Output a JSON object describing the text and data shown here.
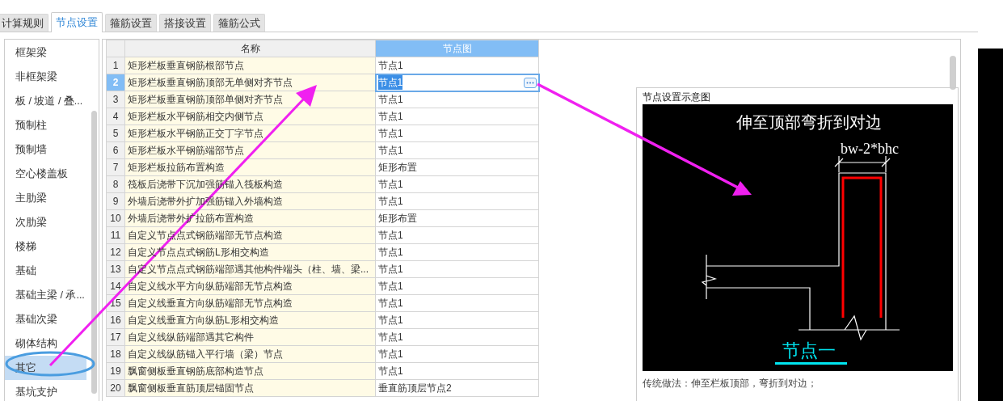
{
  "tabs": [
    {
      "label": "计算规则",
      "selected": false
    },
    {
      "label": "节点设置",
      "selected": true
    },
    {
      "label": "箍筋设置",
      "selected": false
    },
    {
      "label": "搭接设置",
      "selected": false
    },
    {
      "label": "箍筋公式",
      "selected": false
    }
  ],
  "sidebar": {
    "items": [
      {
        "label": "框架梁",
        "selected": false
      },
      {
        "label": "非框架梁",
        "selected": false
      },
      {
        "label": "板 / 坡道 / 叠...",
        "selected": false
      },
      {
        "label": "预制柱",
        "selected": false
      },
      {
        "label": "预制墙",
        "selected": false
      },
      {
        "label": "空心楼盖板",
        "selected": false
      },
      {
        "label": "主肋梁",
        "selected": false
      },
      {
        "label": "次肋梁",
        "selected": false
      },
      {
        "label": "楼梯",
        "selected": false
      },
      {
        "label": "基础",
        "selected": false
      },
      {
        "label": "基础主梁 / 承...",
        "selected": false
      },
      {
        "label": "基础次梁",
        "selected": false
      },
      {
        "label": "砌体结构",
        "selected": false
      },
      {
        "label": "其它",
        "selected": true
      },
      {
        "label": "基坑支护",
        "selected": false
      }
    ]
  },
  "table": {
    "columns": [
      {
        "label": "名称",
        "selected": false
      },
      {
        "label": "节点图",
        "selected": true
      }
    ],
    "rows": [
      {
        "number": "1",
        "name": "矩形栏板垂直钢筋根部节点",
        "node": "节点1",
        "selected": false
      },
      {
        "number": "2",
        "name": "矩形栏板垂直钢筋顶部无单侧对齐节点",
        "node": "节点1",
        "selected": true
      },
      {
        "number": "3",
        "name": "矩形栏板垂直钢筋顶部单侧对齐节点",
        "node": "节点1",
        "selected": false
      },
      {
        "number": "4",
        "name": "矩形栏板水平钢筋相交内侧节点",
        "node": "节点1",
        "selected": false
      },
      {
        "number": "5",
        "name": "矩形栏板水平钢筋正交丁字节点",
        "node": "节点1",
        "selected": false
      },
      {
        "number": "6",
        "name": "矩形栏板水平钢筋端部节点",
        "node": "节点1",
        "selected": false
      },
      {
        "number": "7",
        "name": "矩形栏板拉筋布置构造",
        "node": "矩形布置",
        "selected": false
      },
      {
        "number": "8",
        "name": "筏板后浇带下沉加强筋锚入筏板构造",
        "node": "节点1",
        "selected": false
      },
      {
        "number": "9",
        "name": "外墙后浇带外扩加强筋锚入外墙构造",
        "node": "节点1",
        "selected": false
      },
      {
        "number": "10",
        "name": "外墙后浇带外扩拉筋布置构造",
        "node": "矩形布置",
        "selected": false
      },
      {
        "number": "11",
        "name": "自定义节点点式钢筋端部无节点构造",
        "node": "节点1",
        "selected": false
      },
      {
        "number": "12",
        "name": "自定义节点点式钢筋L形相交构造",
        "node": "节点1",
        "selected": false
      },
      {
        "number": "13",
        "name": "自定义节点点式钢筋端部遇其他构件端头（柱、墙、梁...",
        "node": "节点1",
        "selected": false
      },
      {
        "number": "14",
        "name": "自定义线水平方向纵筋端部无节点构造",
        "node": "节点1",
        "selected": false
      },
      {
        "number": "15",
        "name": "自定义线垂直方向纵筋端部无节点构造",
        "node": "节点1",
        "selected": false
      },
      {
        "number": "16",
        "name": "自定义线垂直方向纵筋L形相交构造",
        "node": "节点1",
        "selected": false
      },
      {
        "number": "17",
        "name": "自定义线纵筋端部遇其它构件",
        "node": "节点1",
        "selected": false
      },
      {
        "number": "18",
        "name": "自定义线纵筋锚入平行墙（梁）节点",
        "node": "节点1",
        "selected": false
      },
      {
        "number": "19",
        "name": "飘窗侧板垂直钢筋底部构造节点",
        "node": "节点1",
        "selected": false
      },
      {
        "number": "20",
        "name": "飘窗侧板垂直筋顶层锚固节点",
        "node": "垂直筋顶层节点2",
        "selected": false
      }
    ]
  },
  "preview": {
    "title": "节点设置示意图",
    "diagram": {
      "heading": "伸至顶部弯折到对边",
      "dimension": "bw-2*bhc",
      "caption": "节点一"
    },
    "description": "传统做法：伸至栏板顶部，弯折到对边；"
  }
}
